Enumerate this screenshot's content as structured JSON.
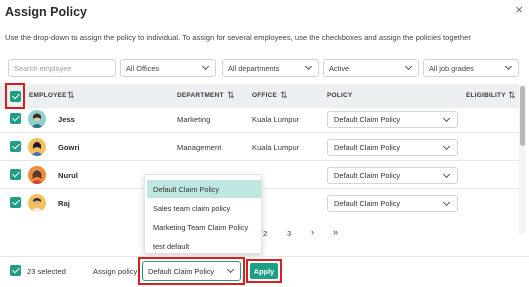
{
  "dialog": {
    "title": "Assign Policy",
    "close_icon": "×",
    "description": "Use the drop-down to assign the policy to individual. To assign for several employees, use the checkboxes and assign the policies together"
  },
  "filters": {
    "search_placeholder": "Search employee",
    "offices": "All Offices",
    "departments": "All departments",
    "status": "Active",
    "job_grades": "All job grades"
  },
  "table": {
    "headers": {
      "employee": "EMPLOYEE",
      "department": "DEPARTMENT",
      "office": "OFFICE",
      "policy": "POLICY",
      "eligibility": "ELIGIBILITY"
    },
    "sort_icon": "⇅",
    "rows": [
      {
        "name": "Jess",
        "department": "Marketing",
        "office": "Kuala Lumpur",
        "policy": "Default Claim Policy"
      },
      {
        "name": "Gowri",
        "department": "Management",
        "office": "Kuala Lumpur",
        "policy": "Default Claim Policy"
      },
      {
        "name": "Nurul",
        "department": "",
        "office": "",
        "policy": "Default Claim Policy"
      },
      {
        "name": "Raj",
        "department": "",
        "office": "",
        "policy": "Default Claim Policy"
      }
    ]
  },
  "dropdown": {
    "options": [
      "Default Claim Policy",
      "Sales team claim policy",
      "Marketing Team Claim Policy",
      "test default"
    ],
    "selected": "Default Claim Policy"
  },
  "pagination": {
    "pages": [
      "2",
      "3"
    ],
    "next": "›",
    "last": "»"
  },
  "footer": {
    "selected_count": "23 selected",
    "assign_label": "Assign policy",
    "assign_value": "Default Claim Policy",
    "apply_label": "Apply"
  },
  "colors": {
    "accent": "#1f9e86",
    "highlight": "#d62020",
    "selected_option": "#bfe7e2"
  }
}
